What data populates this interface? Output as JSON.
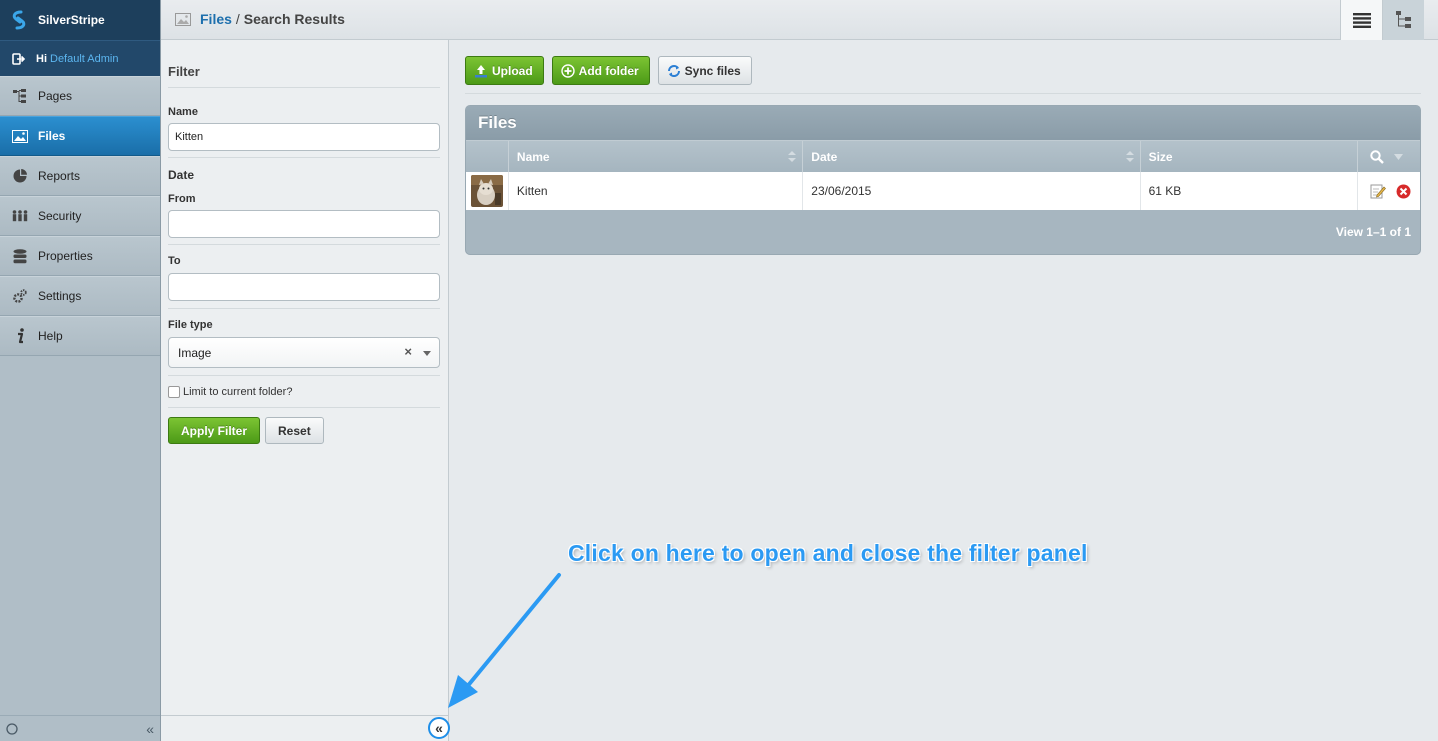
{
  "brand": {
    "name": "SilverStripe"
  },
  "user": {
    "greeting": "Hi",
    "name": "Default Admin"
  },
  "nav": {
    "items": [
      {
        "label": "Pages",
        "icon": "sitetree-icon",
        "active": false
      },
      {
        "label": "Files",
        "icon": "image-icon",
        "active": true
      },
      {
        "label": "Reports",
        "icon": "pie-chart-icon",
        "active": false
      },
      {
        "label": "Security",
        "icon": "users-icon",
        "active": false
      },
      {
        "label": "Properties",
        "icon": "database-icon",
        "active": false
      },
      {
        "label": "Settings",
        "icon": "gear-icon",
        "active": false
      },
      {
        "label": "Help",
        "icon": "info-icon",
        "active": false
      }
    ],
    "collapse_symbol": "«"
  },
  "header": {
    "crumb_link": "Files",
    "crumb_sep": "/",
    "crumb_current": "Search Results"
  },
  "filter": {
    "title": "Filter",
    "name_label": "Name",
    "name_value": "Kitten",
    "date_label": "Date",
    "from_label": "From",
    "from_value": "",
    "to_label": "To",
    "to_value": "",
    "filetype_label": "File type",
    "filetype_value": "Image",
    "filetype_clear": "×",
    "limit_label": "Limit to current folder?",
    "apply_label": "Apply Filter",
    "reset_label": "Reset",
    "toggle_symbol": "«"
  },
  "toolbar": {
    "upload_label": "Upload",
    "add_folder_label": "Add folder",
    "sync_label": "Sync files"
  },
  "grid": {
    "title": "Files",
    "columns": [
      "Name",
      "Date",
      "Size"
    ],
    "rows": [
      {
        "name": "Kitten",
        "date": "23/06/2015",
        "size": "61 KB"
      }
    ],
    "pagination": "View 1–1 of 1"
  },
  "annotation": {
    "text": "Click on here to open and close the filter panel",
    "color": "#2b9af3"
  },
  "colors": {
    "nav_active": "#1a6ea8",
    "green_button": "#4c9a17",
    "link": "#1d6fad"
  }
}
